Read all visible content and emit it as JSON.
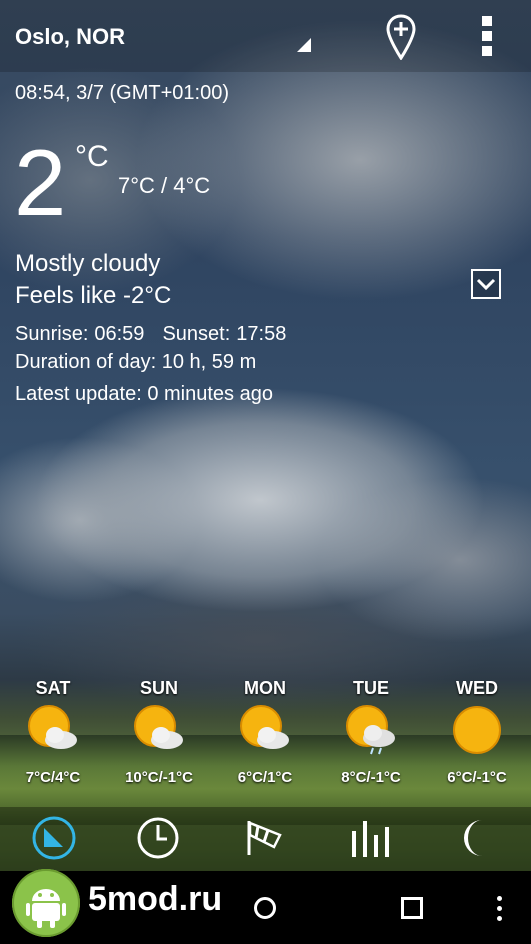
{
  "header": {
    "city": "Oslo, NOR",
    "add_location_icon": "add-location-pin-icon",
    "menu_icon": "overflow-menu-icon"
  },
  "current": {
    "datetime": "08:54, 3/7 (GMT+01:00)",
    "temperature": "2",
    "unit": "°C",
    "high_low": "7°C / 4°C",
    "condition": "Mostly cloudy",
    "feels_like": "Feels like -2°C",
    "sunrise_label": "Sunrise:",
    "sunrise": "06:59",
    "sunset_label": "Sunset:",
    "sunset": "17:58",
    "duration": "Duration of day: 10 h, 59 m",
    "update": "Latest update: 0 minutes ago"
  },
  "forecast": [
    {
      "day": "SAT",
      "range": "7°C/4°C",
      "icon": "partly-cloudy-icon"
    },
    {
      "day": "SUN",
      "range": "10°C/-1°C",
      "icon": "partly-cloudy-icon"
    },
    {
      "day": "MON",
      "range": "6°C/1°C",
      "icon": "partly-cloudy-icon"
    },
    {
      "day": "TUE",
      "range": "8°C/-1°C",
      "icon": "partly-cloudy-rain-icon"
    },
    {
      "day": "WED",
      "range": "6°C/-1°C",
      "icon": "sunny-icon"
    }
  ],
  "tabs": [
    {
      "name": "overview",
      "icon": "overview-icon",
      "active": true
    },
    {
      "name": "hourly",
      "icon": "clock-icon",
      "active": false
    },
    {
      "name": "wind",
      "icon": "windsock-icon",
      "active": false
    },
    {
      "name": "charts",
      "icon": "bar-chart-icon",
      "active": false
    },
    {
      "name": "moon",
      "icon": "moon-icon",
      "active": false
    }
  ],
  "watermark": {
    "text": "5mod.ru"
  },
  "colors": {
    "accent": "#33b5e5",
    "sun": "#f6b40f",
    "cloud": "#e6e6e6"
  }
}
